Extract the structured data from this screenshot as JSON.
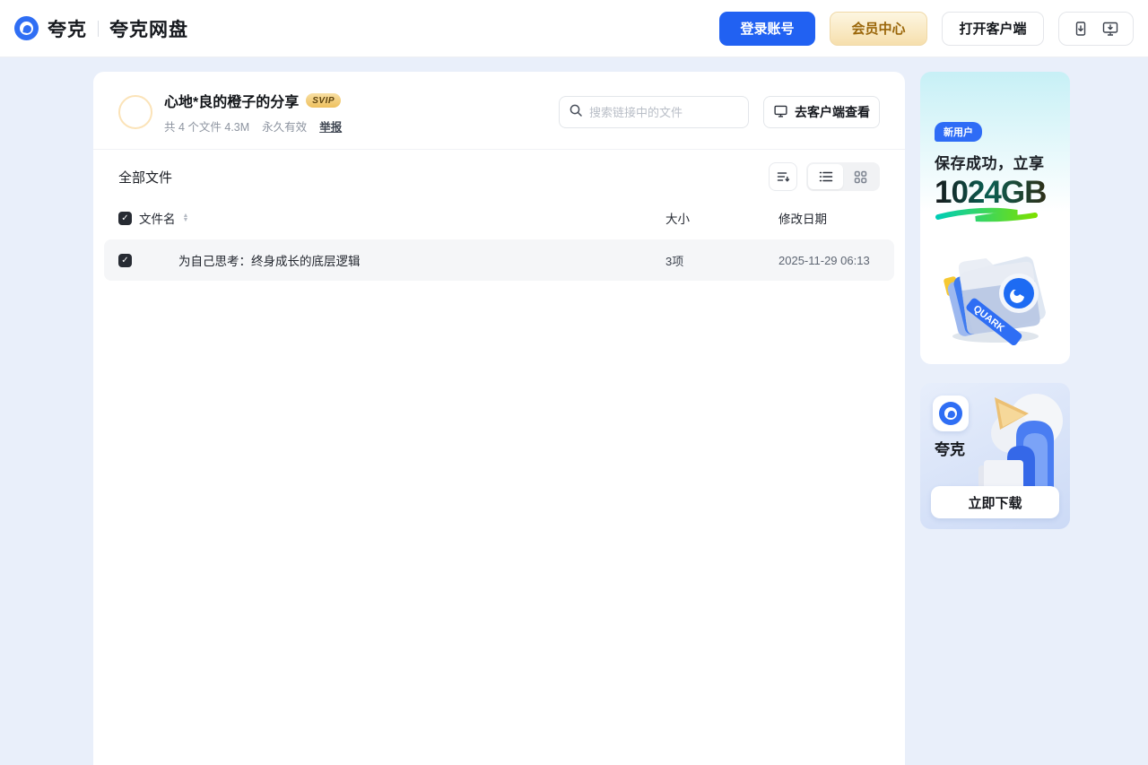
{
  "header": {
    "brand": "夸克",
    "product": "夸克网盘",
    "login_button": "登录账号",
    "vip_button": "会员中心",
    "open_client_button": "打开客户端"
  },
  "share": {
    "title": "心地*良的橙子的分享",
    "badge": "SVIP",
    "meta_files": "共 4 个文件 4.3M",
    "meta_valid": "永久有效",
    "report_link": "举报",
    "search_placeholder": "搜索链接中的文件",
    "view_in_client_button": "去客户端查看"
  },
  "toolbar": {
    "all_files_label": "全部文件"
  },
  "table": {
    "columns": {
      "name": "文件名",
      "size": "大小",
      "modified": "修改日期"
    },
    "rows": [
      {
        "name": "为自己思考：终身成长的底层逻辑",
        "size": "3项",
        "modified": "2025-11-29 06:13"
      }
    ],
    "sort_asc_glyph": "▲",
    "sort_desc_glyph": "▼",
    "check_glyph": "✓"
  },
  "promo": {
    "new_user_badge": "新用户",
    "line1": "保存成功，立享",
    "capacity": "1024GB",
    "ribbon_text": "QUARK"
  },
  "download_card": {
    "app_name": "夸克",
    "button": "立即下载"
  },
  "colors": {
    "accent_blue": "#2161f2",
    "vip_gold_text": "#9a660a",
    "page_background": "#e9effa",
    "row_background": "#f5f6f8",
    "swoosh_start": "#00cdb4",
    "swoosh_end": "#7be000"
  }
}
